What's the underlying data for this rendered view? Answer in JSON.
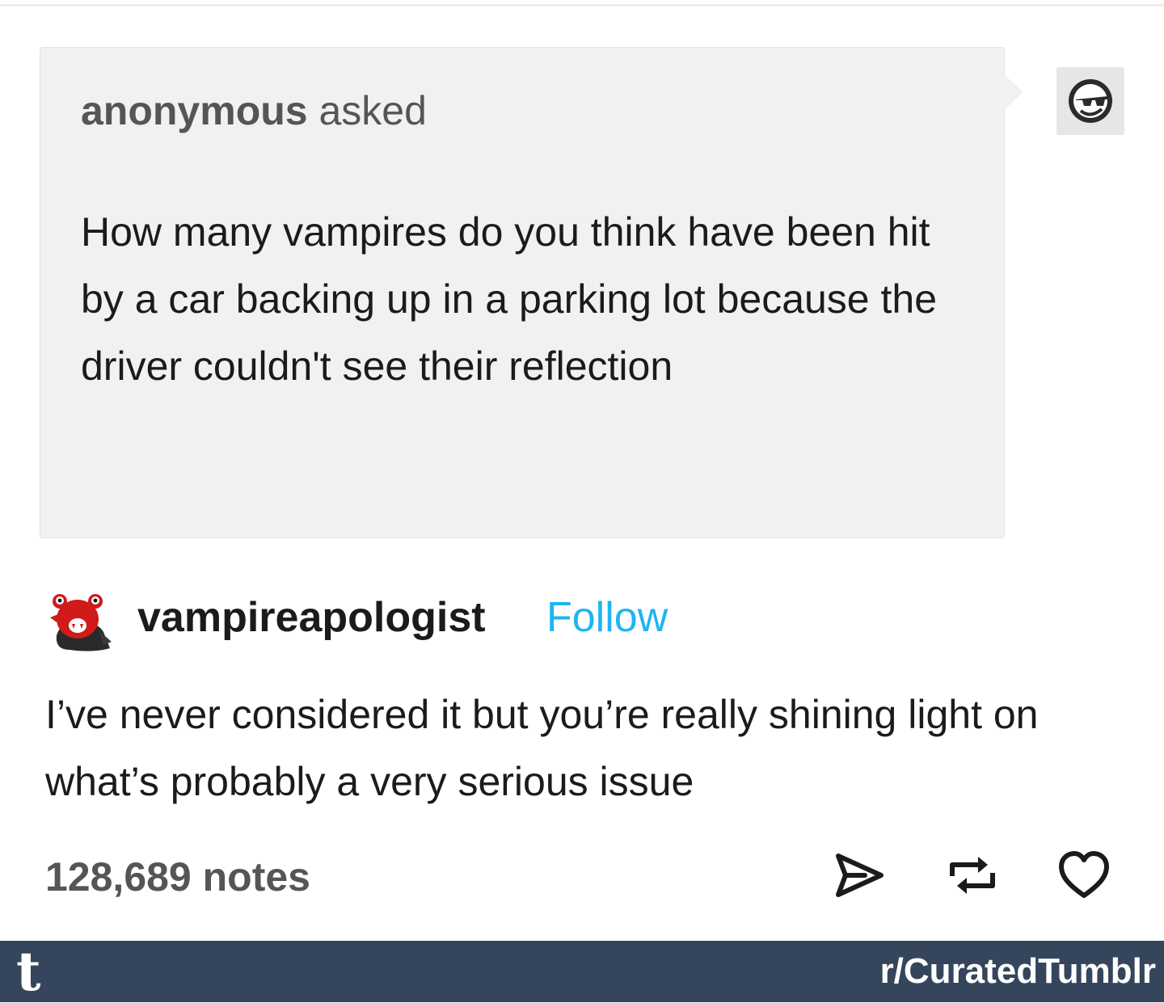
{
  "ask": {
    "asker_name": "anonymous",
    "asker_verb": "asked",
    "question": "How many vampires do you think have been hit by a car backing up in a parking lot because the driver couldn't see their reflection"
  },
  "anon_avatar": {
    "icon": "sunglasses-face-icon"
  },
  "answer": {
    "blog_name": "vampireapologist",
    "follow_label": "Follow",
    "text": "I’ve never considered it but you’re really shining light on what’s probably a very serious issue",
    "avatar_icon": "vampire-blob-avatar"
  },
  "footer": {
    "notes": "128,689 notes",
    "actions": [
      "share-icon",
      "reblog-icon",
      "heart-icon"
    ]
  },
  "brand_bar": {
    "logo": "t",
    "subreddit": "r/CuratedTumblr"
  },
  "colors": {
    "bubble": "#f1f1f1",
    "follow": "#1fb5f0",
    "brand_bar": "#35465c",
    "muted_text": "#555555"
  }
}
